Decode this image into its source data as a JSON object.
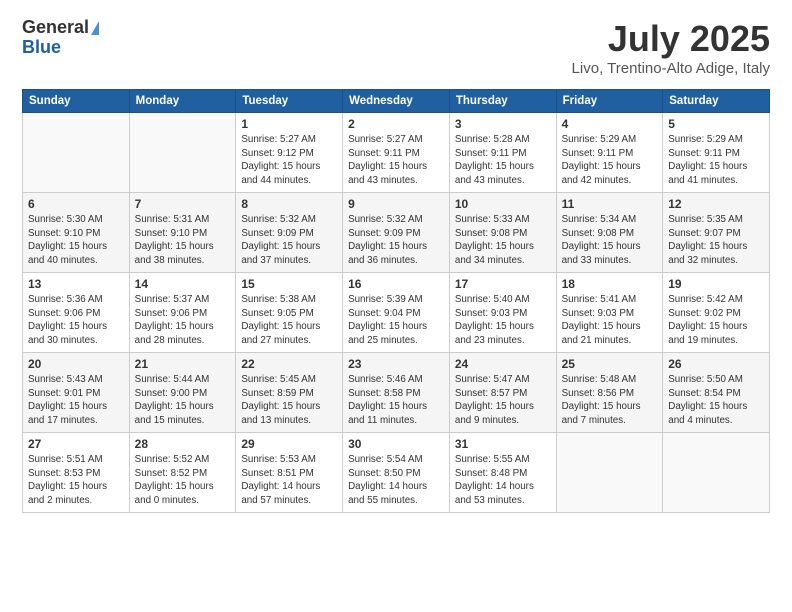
{
  "header": {
    "logo_general": "General",
    "logo_blue": "Blue",
    "title": "July 2025",
    "location": "Livo, Trentino-Alto Adige, Italy"
  },
  "days_of_week": [
    "Sunday",
    "Monday",
    "Tuesday",
    "Wednesday",
    "Thursday",
    "Friday",
    "Saturday"
  ],
  "weeks": [
    [
      {
        "num": "",
        "detail": ""
      },
      {
        "num": "",
        "detail": ""
      },
      {
        "num": "1",
        "detail": "Sunrise: 5:27 AM\nSunset: 9:12 PM\nDaylight: 15 hours\nand 44 minutes."
      },
      {
        "num": "2",
        "detail": "Sunrise: 5:27 AM\nSunset: 9:11 PM\nDaylight: 15 hours\nand 43 minutes."
      },
      {
        "num": "3",
        "detail": "Sunrise: 5:28 AM\nSunset: 9:11 PM\nDaylight: 15 hours\nand 43 minutes."
      },
      {
        "num": "4",
        "detail": "Sunrise: 5:29 AM\nSunset: 9:11 PM\nDaylight: 15 hours\nand 42 minutes."
      },
      {
        "num": "5",
        "detail": "Sunrise: 5:29 AM\nSunset: 9:11 PM\nDaylight: 15 hours\nand 41 minutes."
      }
    ],
    [
      {
        "num": "6",
        "detail": "Sunrise: 5:30 AM\nSunset: 9:10 PM\nDaylight: 15 hours\nand 40 minutes."
      },
      {
        "num": "7",
        "detail": "Sunrise: 5:31 AM\nSunset: 9:10 PM\nDaylight: 15 hours\nand 38 minutes."
      },
      {
        "num": "8",
        "detail": "Sunrise: 5:32 AM\nSunset: 9:09 PM\nDaylight: 15 hours\nand 37 minutes."
      },
      {
        "num": "9",
        "detail": "Sunrise: 5:32 AM\nSunset: 9:09 PM\nDaylight: 15 hours\nand 36 minutes."
      },
      {
        "num": "10",
        "detail": "Sunrise: 5:33 AM\nSunset: 9:08 PM\nDaylight: 15 hours\nand 34 minutes."
      },
      {
        "num": "11",
        "detail": "Sunrise: 5:34 AM\nSunset: 9:08 PM\nDaylight: 15 hours\nand 33 minutes."
      },
      {
        "num": "12",
        "detail": "Sunrise: 5:35 AM\nSunset: 9:07 PM\nDaylight: 15 hours\nand 32 minutes."
      }
    ],
    [
      {
        "num": "13",
        "detail": "Sunrise: 5:36 AM\nSunset: 9:06 PM\nDaylight: 15 hours\nand 30 minutes."
      },
      {
        "num": "14",
        "detail": "Sunrise: 5:37 AM\nSunset: 9:06 PM\nDaylight: 15 hours\nand 28 minutes."
      },
      {
        "num": "15",
        "detail": "Sunrise: 5:38 AM\nSunset: 9:05 PM\nDaylight: 15 hours\nand 27 minutes."
      },
      {
        "num": "16",
        "detail": "Sunrise: 5:39 AM\nSunset: 9:04 PM\nDaylight: 15 hours\nand 25 minutes."
      },
      {
        "num": "17",
        "detail": "Sunrise: 5:40 AM\nSunset: 9:03 PM\nDaylight: 15 hours\nand 23 minutes."
      },
      {
        "num": "18",
        "detail": "Sunrise: 5:41 AM\nSunset: 9:03 PM\nDaylight: 15 hours\nand 21 minutes."
      },
      {
        "num": "19",
        "detail": "Sunrise: 5:42 AM\nSunset: 9:02 PM\nDaylight: 15 hours\nand 19 minutes."
      }
    ],
    [
      {
        "num": "20",
        "detail": "Sunrise: 5:43 AM\nSunset: 9:01 PM\nDaylight: 15 hours\nand 17 minutes."
      },
      {
        "num": "21",
        "detail": "Sunrise: 5:44 AM\nSunset: 9:00 PM\nDaylight: 15 hours\nand 15 minutes."
      },
      {
        "num": "22",
        "detail": "Sunrise: 5:45 AM\nSunset: 8:59 PM\nDaylight: 15 hours\nand 13 minutes."
      },
      {
        "num": "23",
        "detail": "Sunrise: 5:46 AM\nSunset: 8:58 PM\nDaylight: 15 hours\nand 11 minutes."
      },
      {
        "num": "24",
        "detail": "Sunrise: 5:47 AM\nSunset: 8:57 PM\nDaylight: 15 hours\nand 9 minutes."
      },
      {
        "num": "25",
        "detail": "Sunrise: 5:48 AM\nSunset: 8:56 PM\nDaylight: 15 hours\nand 7 minutes."
      },
      {
        "num": "26",
        "detail": "Sunrise: 5:50 AM\nSunset: 8:54 PM\nDaylight: 15 hours\nand 4 minutes."
      }
    ],
    [
      {
        "num": "27",
        "detail": "Sunrise: 5:51 AM\nSunset: 8:53 PM\nDaylight: 15 hours\nand 2 minutes."
      },
      {
        "num": "28",
        "detail": "Sunrise: 5:52 AM\nSunset: 8:52 PM\nDaylight: 15 hours\nand 0 minutes."
      },
      {
        "num": "29",
        "detail": "Sunrise: 5:53 AM\nSunset: 8:51 PM\nDaylight: 14 hours\nand 57 minutes."
      },
      {
        "num": "30",
        "detail": "Sunrise: 5:54 AM\nSunset: 8:50 PM\nDaylight: 14 hours\nand 55 minutes."
      },
      {
        "num": "31",
        "detail": "Sunrise: 5:55 AM\nSunset: 8:48 PM\nDaylight: 14 hours\nand 53 minutes."
      },
      {
        "num": "",
        "detail": ""
      },
      {
        "num": "",
        "detail": ""
      }
    ]
  ]
}
